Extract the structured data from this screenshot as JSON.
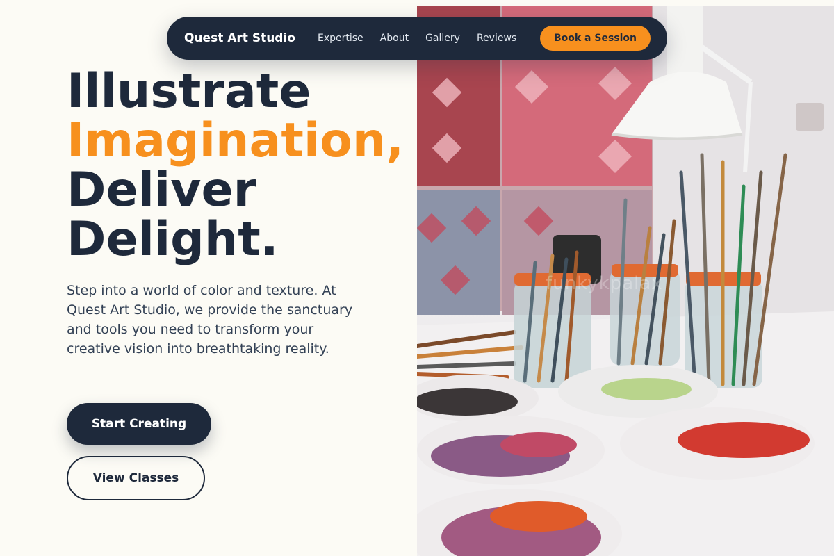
{
  "nav": {
    "brand": "Quest Art Studio",
    "links": [
      "Expertise",
      "About",
      "Gallery",
      "Reviews"
    ],
    "cta": "Book a Session"
  },
  "hero": {
    "headline_line1": "Illustrate",
    "headline_accent": "Imagination,",
    "headline_line3": "Deliver",
    "headline_line4": "Delight.",
    "subtitle": "Step into a world of color and texture. At Quest Art Studio, we provide the sanctuary and tools you need to transform your creative vision into breathtaking reality.",
    "primary_button": "Start Creating",
    "secondary_button": "View Classes"
  },
  "photo": {
    "watermark": "funkykpalax"
  },
  "colors": {
    "navy": "#1e293b",
    "accent": "#f7901e",
    "background": "#fcfbf5"
  }
}
